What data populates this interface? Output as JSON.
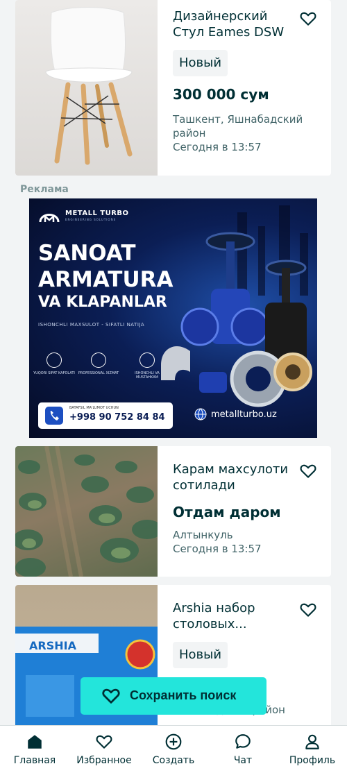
{
  "listings": [
    {
      "title": "Дизайнерский Стул Eames DSW",
      "condition": "Новый",
      "price": "300 000 сум",
      "location": "Ташкент, Яшнабадский район",
      "date": "Сегодня в 13:57"
    },
    {
      "title": "Карам махсулоти сотилади",
      "price": "Отдам даром",
      "location": "Алтынкуль",
      "date": "Сегодня в 13:57"
    },
    {
      "title": "Arshia набор столовых...",
      "condition": "Новый",
      "location_partial": "адский район"
    }
  ],
  "ad": {
    "label": "Реклама",
    "brand": "METALL TURBO",
    "brand_sub": "ENGINEERING SOLUTIONS",
    "headline_1": "SANOAT",
    "headline_2": "ARMATURA",
    "headline_3": "VA KLAPANLAR",
    "tagline": "ISHONCHLI MAXSULOT - SIFATLI NATIJA",
    "features": [
      "YUQORI SIFAT KAFOLATI",
      "PROFESSIONAL XIZMAT",
      "ISHONCHLI VA MUSTAHKAM"
    ],
    "phone_caption": "BATAFSIL MA'LUMOT UCHUN",
    "phone": "+998 90 752 84 84",
    "website": "metallturbo.uz"
  },
  "save_search": {
    "label": "Сохранить поиск"
  },
  "bottom_nav": [
    {
      "label": "Главная",
      "icon": "home-icon"
    },
    {
      "label": "Избранное",
      "icon": "heart-icon"
    },
    {
      "label": "Создать",
      "icon": "plus-circle-icon"
    },
    {
      "label": "Чат",
      "icon": "chat-icon"
    },
    {
      "label": "Профиль",
      "icon": "profile-icon"
    }
  ],
  "colors": {
    "accent": "#23e5db",
    "text": "#002f34",
    "muted": "#406367"
  }
}
